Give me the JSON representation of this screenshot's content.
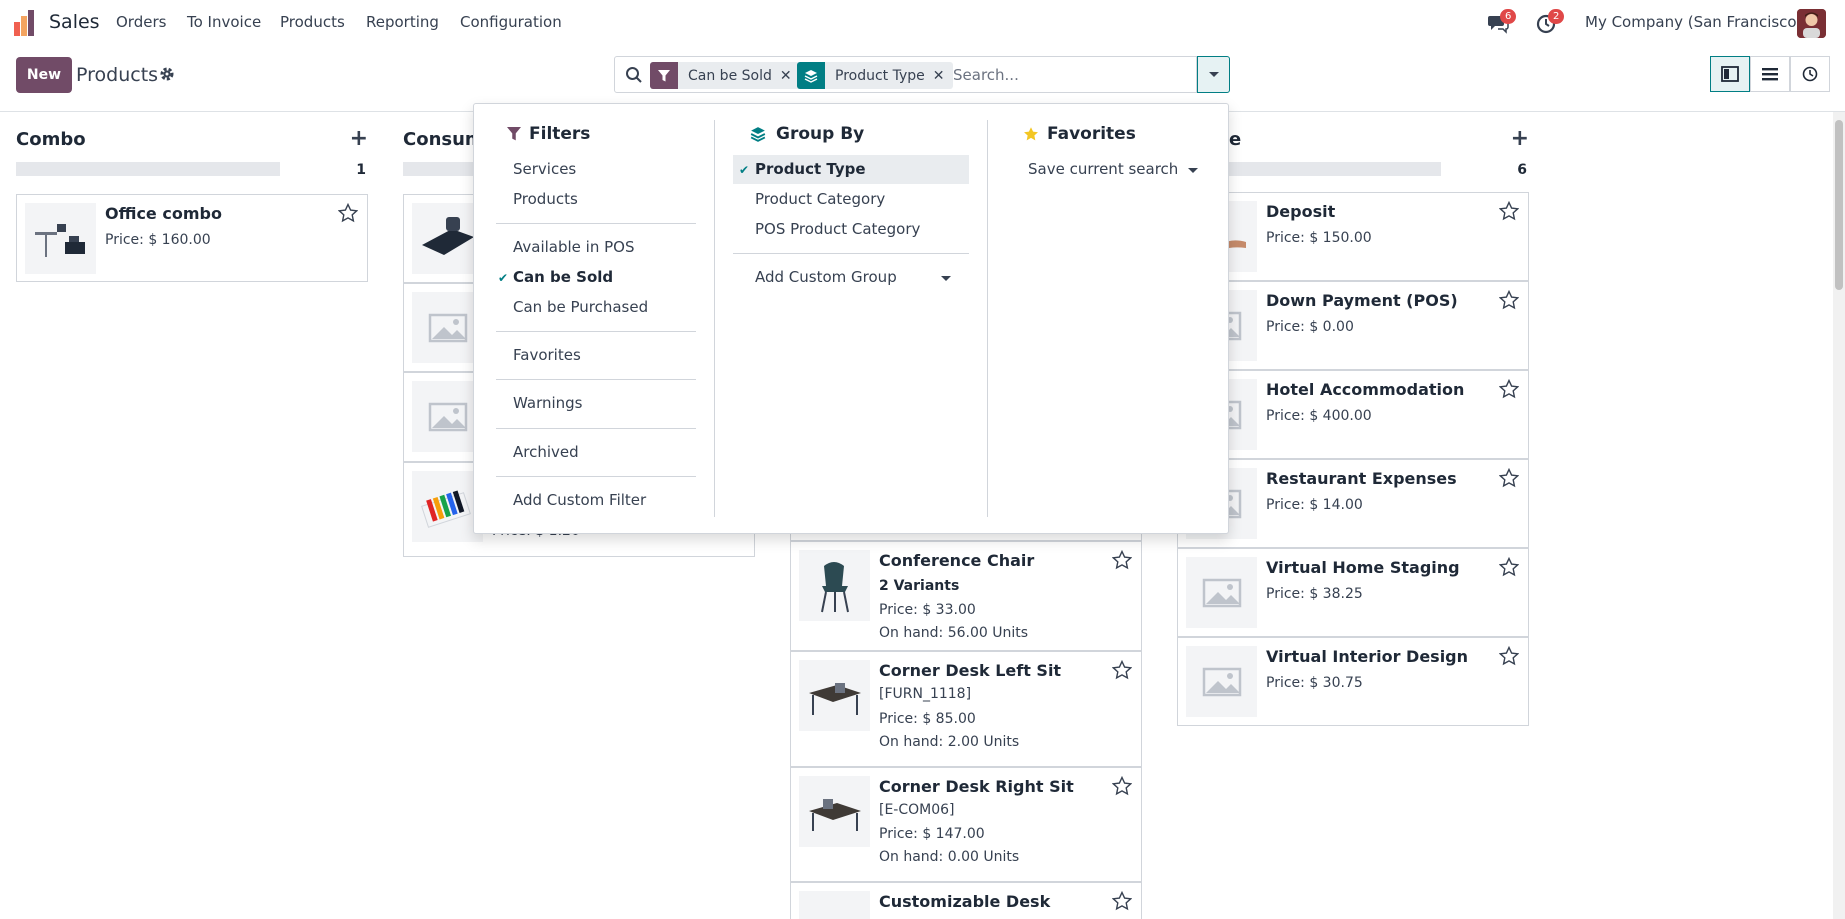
{
  "navbar": {
    "app_name": "Sales",
    "menu": [
      "Orders",
      "To Invoice",
      "Products",
      "Reporting",
      "Configuration"
    ],
    "messages_count": "6",
    "activities_count": "2",
    "company": "My Company (San Francisco)"
  },
  "control_panel": {
    "new_label": "New",
    "title": "Products",
    "facets": [
      {
        "label": "Can be Sold",
        "icon": "filter-icon",
        "color": "#714b67"
      },
      {
        "label": "Product Type",
        "icon": "layers-icon",
        "color": "#017e84"
      }
    ],
    "search_placeholder": "Search..."
  },
  "kanban": {
    "columns": [
      {
        "title": "Combo",
        "count": "1",
        "cards": [
          {
            "name": "Office combo",
            "lines": [
              "Price: $ 160.00"
            ]
          }
        ]
      },
      {
        "title": "Consum",
        "count": "",
        "cards": [
          {
            "name": "",
            "lines": []
          },
          {
            "name": "",
            "lines": []
          },
          {
            "name": "",
            "lines": []
          },
          {
            "name": "",
            "lines": [
              "Price: $ 1.20"
            ]
          }
        ]
      },
      {
        "title": "",
        "count": "",
        "cards": [
          {
            "name": "Conference Chair",
            "lines": [
              "2 Variants",
              "Price: $ 33.00",
              "On hand: 56.00 Units"
            ]
          },
          {
            "name": "Corner Desk Left Sit",
            "lines": [
              "[FURN_1118]",
              "Price: $ 85.00",
              "On hand: 2.00 Units"
            ]
          },
          {
            "name": "Corner Desk Right Sit",
            "lines": [
              "[E-COM06]",
              "Price: $ 147.00",
              "On hand: 0.00 Units"
            ]
          },
          {
            "name": "Customizable Desk",
            "lines": []
          }
        ]
      },
      {
        "title": "e",
        "count": "6",
        "cards": [
          {
            "name": "Deposit",
            "lines": [
              "Price: $ 150.00"
            ]
          },
          {
            "name": "Down Payment (POS)",
            "lines": [
              "Price: $ 0.00"
            ]
          },
          {
            "name": "Hotel Accommodation",
            "lines": [
              "Price: $ 400.00"
            ]
          },
          {
            "name": "Restaurant Expenses",
            "lines": [
              "Price: $ 14.00"
            ]
          },
          {
            "name": "Virtual Home Staging",
            "lines": [
              "Price: $ 38.25"
            ]
          },
          {
            "name": "Virtual Interior Design",
            "lines": [
              "Price: $ 30.75"
            ]
          }
        ]
      }
    ]
  },
  "dropdown": {
    "filters": {
      "heading": "Filters",
      "items": [
        "Services",
        "Products",
        "Available in POS",
        "Can be Sold",
        "Can be Purchased",
        "Favorites",
        "Warnings",
        "Archived",
        "Add Custom Filter"
      ],
      "checked": "Can be Sold"
    },
    "group_by": {
      "heading": "Group By",
      "items": [
        "Product Type",
        "Product Category",
        "POS Product Category",
        "Add Custom Group"
      ],
      "checked": "Product Type"
    },
    "favorites": {
      "heading": "Favorites",
      "items": [
        "Save current search"
      ]
    }
  },
  "colors": {
    "brand": "#714b67",
    "accent": "#017e84",
    "star": "#f3c623"
  }
}
